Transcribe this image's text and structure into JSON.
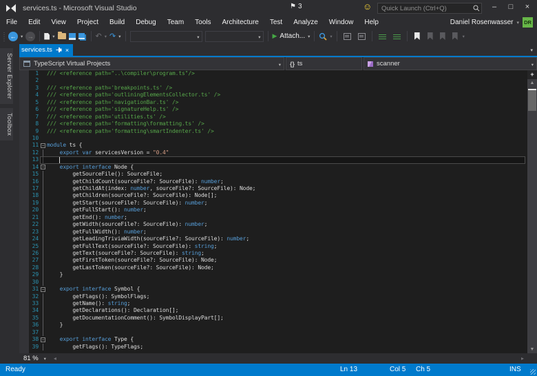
{
  "window": {
    "title": "services.ts - Microsoft Visual Studio",
    "notification_count": "3",
    "quick_launch_placeholder": "Quick Launch (Ctrl+Q)",
    "user_name": "Daniel Rosenwasser",
    "user_initials": "DR"
  },
  "icons": {
    "flag": "⚑",
    "smiley": "☺",
    "minimize": "–",
    "maximize": "□",
    "close": "×",
    "back": "←",
    "forward": "→",
    "undo": "↶",
    "redo": "↷",
    "play": "▶",
    "caret": "▾",
    "up_arrow": "▲",
    "down_arrow": "▼",
    "left_arrow": "◂",
    "right_arrow": "▸",
    "fold_collapse": "−",
    "split": "+",
    "tab_close": "×"
  },
  "menus": [
    "File",
    "Edit",
    "View",
    "Project",
    "Build",
    "Debug",
    "Team",
    "Tools",
    "Architecture",
    "Test",
    "Analyze",
    "Window",
    "Help"
  ],
  "toolbar": {
    "attach_label": "Attach..."
  },
  "side_tabs": [
    "Server Explorer",
    "Toolbox"
  ],
  "tab": {
    "title": "services.ts"
  },
  "navbar": {
    "project": "TypeScript Virtual Projects",
    "scope_icon": "{}",
    "scope": "ts",
    "member": "scanner"
  },
  "editor": {
    "zoom_level": "81 %",
    "lines": [
      {
        "n": "1",
        "fold": "",
        "seg": [
          [
            "cm",
            "/// <reference path=\"..\\compiler\\program.ts\"/>"
          ]
        ]
      },
      {
        "n": "2",
        "fold": "",
        "seg": []
      },
      {
        "n": "3",
        "fold": "",
        "seg": [
          [
            "cm",
            "/// <reference path='breakpoints.ts' />"
          ]
        ]
      },
      {
        "n": "4",
        "fold": "",
        "seg": [
          [
            "cm",
            "/// <reference path='outliningElementsCollector.ts' />"
          ]
        ]
      },
      {
        "n": "5",
        "fold": "",
        "seg": [
          [
            "cm",
            "/// <reference path='navigationBar.ts' />"
          ]
        ]
      },
      {
        "n": "6",
        "fold": "",
        "seg": [
          [
            "cm",
            "/// <reference path='signatureHelp.ts' />"
          ]
        ]
      },
      {
        "n": "7",
        "fold": "",
        "seg": [
          [
            "cm",
            "/// <reference path='utilities.ts' />"
          ]
        ]
      },
      {
        "n": "8",
        "fold": "",
        "seg": [
          [
            "cm",
            "/// <reference path='formatting\\formatting.ts' />"
          ]
        ]
      },
      {
        "n": "9",
        "fold": "",
        "seg": [
          [
            "cm",
            "/// <reference path='formatting\\smartIndenter.ts' />"
          ]
        ]
      },
      {
        "n": "10",
        "fold": "",
        "seg": []
      },
      {
        "n": "11",
        "fold": "box",
        "seg": [
          [
            "kw",
            "module"
          ],
          [
            "pl",
            " ts {"
          ]
        ]
      },
      {
        "n": "12",
        "fold": "line",
        "seg": [
          [
            "pl",
            "    "
          ],
          [
            "kw",
            "export"
          ],
          [
            "pl",
            " "
          ],
          [
            "kw",
            "var"
          ],
          [
            "pl",
            " servicesVersion = "
          ],
          [
            "st",
            "\"0.4\""
          ]
        ]
      },
      {
        "n": "13",
        "fold": "line",
        "cur": true,
        "seg": []
      },
      {
        "n": "14",
        "fold": "box",
        "seg": [
          [
            "pl",
            "    "
          ],
          [
            "kw",
            "export"
          ],
          [
            "pl",
            " "
          ],
          [
            "kw",
            "interface"
          ],
          [
            "pl",
            " Node {"
          ]
        ]
      },
      {
        "n": "15",
        "fold": "line",
        "seg": [
          [
            "pl",
            "        getSourceFile(): SourceFile;"
          ]
        ]
      },
      {
        "n": "16",
        "fold": "line",
        "seg": [
          [
            "pl",
            "        getChildCount(sourceFile?: SourceFile): "
          ],
          [
            "kw",
            "number"
          ],
          [
            "pl",
            ";"
          ]
        ]
      },
      {
        "n": "17",
        "fold": "line",
        "seg": [
          [
            "pl",
            "        getChildAt(index: "
          ],
          [
            "kw",
            "number"
          ],
          [
            "pl",
            ", sourceFile?: SourceFile): Node;"
          ]
        ]
      },
      {
        "n": "18",
        "fold": "line",
        "seg": [
          [
            "pl",
            "        getChildren(sourceFile?: SourceFile): Node[];"
          ]
        ]
      },
      {
        "n": "19",
        "fold": "line",
        "seg": [
          [
            "pl",
            "        getStart(sourceFile?: SourceFile): "
          ],
          [
            "kw",
            "number"
          ],
          [
            "pl",
            ";"
          ]
        ]
      },
      {
        "n": "20",
        "fold": "line",
        "seg": [
          [
            "pl",
            "        getFullStart(): "
          ],
          [
            "kw",
            "number"
          ],
          [
            "pl",
            ";"
          ]
        ]
      },
      {
        "n": "21",
        "fold": "line",
        "seg": [
          [
            "pl",
            "        getEnd(): "
          ],
          [
            "kw",
            "number"
          ],
          [
            "pl",
            ";"
          ]
        ]
      },
      {
        "n": "22",
        "fold": "line",
        "seg": [
          [
            "pl",
            "        getWidth(sourceFile?: SourceFile): "
          ],
          [
            "kw",
            "number"
          ],
          [
            "pl",
            ";"
          ]
        ]
      },
      {
        "n": "23",
        "fold": "line",
        "seg": [
          [
            "pl",
            "        getFullWidth(): "
          ],
          [
            "kw",
            "number"
          ],
          [
            "pl",
            ";"
          ]
        ]
      },
      {
        "n": "24",
        "fold": "line",
        "seg": [
          [
            "pl",
            "        getLeadingTriviaWidth(sourceFile?: SourceFile): "
          ],
          [
            "kw",
            "number"
          ],
          [
            "pl",
            ";"
          ]
        ]
      },
      {
        "n": "25",
        "fold": "line",
        "seg": [
          [
            "pl",
            "        getFullText(sourceFile?: SourceFile): "
          ],
          [
            "kw",
            "string"
          ],
          [
            "pl",
            ";"
          ]
        ]
      },
      {
        "n": "26",
        "fold": "line",
        "seg": [
          [
            "pl",
            "        getText(sourceFile?: SourceFile): "
          ],
          [
            "kw",
            "string"
          ],
          [
            "pl",
            ";"
          ]
        ]
      },
      {
        "n": "27",
        "fold": "line",
        "seg": [
          [
            "pl",
            "        getFirstToken(sourceFile?: SourceFile): Node;"
          ]
        ]
      },
      {
        "n": "28",
        "fold": "line",
        "seg": [
          [
            "pl",
            "        getLastToken(sourceFile?: SourceFile): Node;"
          ]
        ]
      },
      {
        "n": "29",
        "fold": "line",
        "seg": [
          [
            "pl",
            "    }"
          ]
        ]
      },
      {
        "n": "30",
        "fold": "line",
        "seg": []
      },
      {
        "n": "31",
        "fold": "box",
        "seg": [
          [
            "pl",
            "    "
          ],
          [
            "kw",
            "export"
          ],
          [
            "pl",
            " "
          ],
          [
            "kw",
            "interface"
          ],
          [
            "pl",
            " Symbol {"
          ]
        ]
      },
      {
        "n": "32",
        "fold": "line",
        "seg": [
          [
            "pl",
            "        getFlags(): SymbolFlags;"
          ]
        ]
      },
      {
        "n": "33",
        "fold": "line",
        "seg": [
          [
            "pl",
            "        getName(): "
          ],
          [
            "kw",
            "string"
          ],
          [
            "pl",
            ";"
          ]
        ]
      },
      {
        "n": "34",
        "fold": "line",
        "seg": [
          [
            "pl",
            "        getDeclarations(): Declaration[];"
          ]
        ]
      },
      {
        "n": "35",
        "fold": "line",
        "seg": [
          [
            "pl",
            "        getDocumentationComment(): SymbolDisplayPart[];"
          ]
        ]
      },
      {
        "n": "36",
        "fold": "line",
        "seg": [
          [
            "pl",
            "    }"
          ]
        ]
      },
      {
        "n": "37",
        "fold": "line",
        "seg": []
      },
      {
        "n": "38",
        "fold": "box",
        "seg": [
          [
            "pl",
            "    "
          ],
          [
            "kw",
            "export"
          ],
          [
            "pl",
            " "
          ],
          [
            "kw",
            "interface"
          ],
          [
            "pl",
            " Type {"
          ]
        ]
      },
      {
        "n": "39",
        "fold": "line",
        "seg": [
          [
            "pl",
            "        getFlags(): TypeFlags;"
          ]
        ]
      }
    ]
  },
  "status_bar": {
    "ready": "Ready",
    "line": "Ln 13",
    "column": "Col 5",
    "character": "Ch 5",
    "mode": "INS"
  },
  "colors": {
    "accent": "#007ACC",
    "chrome": "#2D2D30",
    "editor_background": "#1E1E1E",
    "comment": "#57A64A",
    "keyword": "#569CD6",
    "string": "#D69D85",
    "text": "#DCDCDC",
    "line_number": "#2B91AF",
    "avatar_green": "#67B648"
  }
}
